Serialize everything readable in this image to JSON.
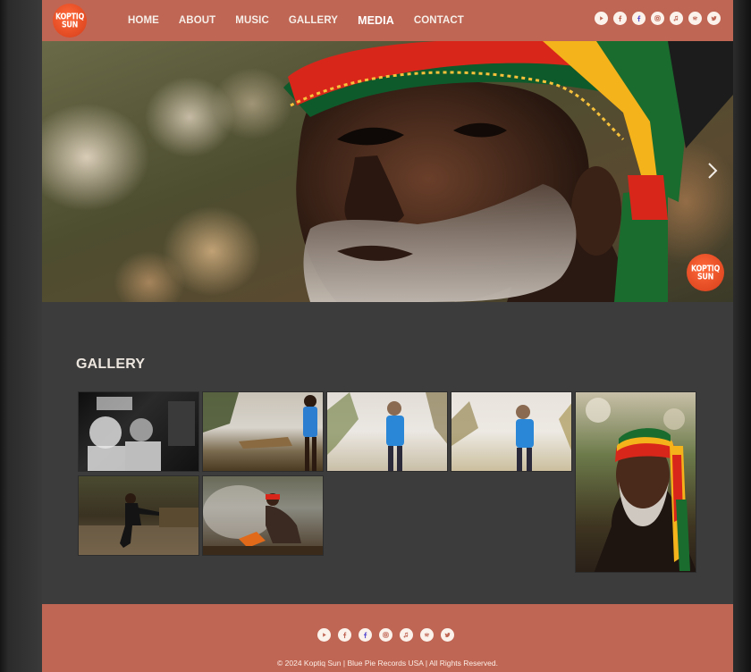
{
  "brand": {
    "logo_line1": "KOPTIQ",
    "logo_line2": "SUN"
  },
  "nav": {
    "items": [
      {
        "label": "HOME"
      },
      {
        "label": "ABOUT"
      },
      {
        "label": "MUSIC"
      },
      {
        "label": "GALLERY"
      },
      {
        "label": "MEDIA",
        "active": true
      },
      {
        "label": "CONTACT"
      }
    ]
  },
  "social_icons": [
    "youtube-icon",
    "facebook-icon",
    "facebook-alt-icon",
    "instagram-icon",
    "itunes-icon",
    "spotify-icon",
    "twitter-icon"
  ],
  "hero": {
    "badge_line1": "KOPTIQ",
    "badge_line2": "SUN",
    "next_icon": "chevron-right-icon"
  },
  "gallery": {
    "title": "GALLERY",
    "photos": [
      "bw-crowd-photo",
      "lake-blue-shirt-photo",
      "lake-blue-shirt-2-photo",
      "lake-blue-shirt-3-photo",
      "portrait-rasta-hat-photo",
      "forest-walk-photo",
      "fire-smoke-photo"
    ]
  },
  "footer": {
    "copyright": "© 2024 Koptiq Sun | Blue Pie Records USA | All Rights Reserved."
  },
  "colors": {
    "header": "#c06654",
    "background": "#3c3c3c",
    "logo": "#e24a23",
    "text_light": "#ece6df"
  }
}
